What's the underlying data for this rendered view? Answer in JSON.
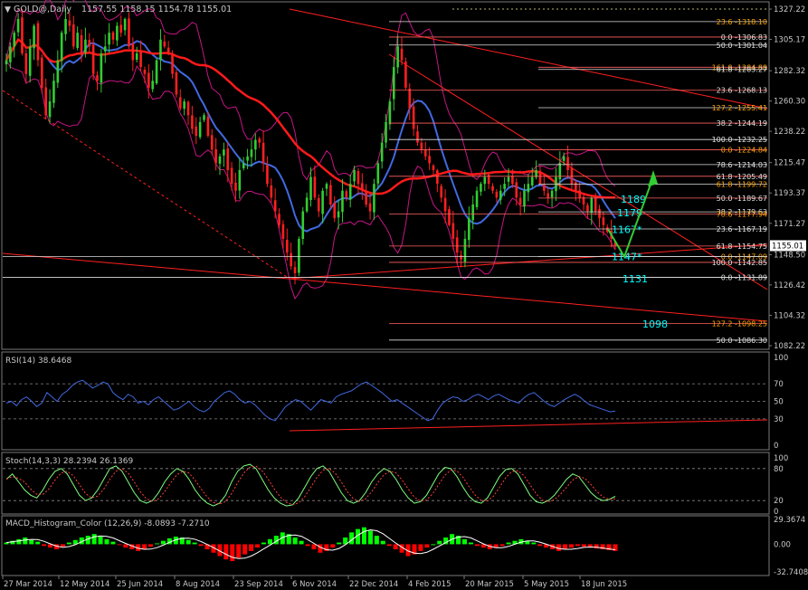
{
  "header": {
    "symbol": "GOLD@,Daily",
    "ohlc": "1157.55 1158.15 1154.78 1155.01"
  },
  "colors": {
    "background": "#000000",
    "grid": "#4a4a4a",
    "axis_text": "#c8c8c8",
    "candle_up": "#32cd32",
    "candle_down": "#ff2020",
    "ma_fast": "#4169e1",
    "ma_slow": "#ff1a1a",
    "bollinger": "#c71585",
    "fib_line": "#ffffff",
    "fib_label": "#ffa500",
    "trend_line": "#ff2020",
    "label_cyan": "#00ffff",
    "arrow_green": "#32cd32",
    "rsi_line": "#4169e1",
    "stoch_main": "#7fff7f",
    "macd_up": "#00ff00",
    "macd_down": "#ff0000",
    "last_price_bg": "#ffffff"
  },
  "chart_data": [
    {
      "type": "candlestick",
      "name": "price",
      "y_ticks": [
        "1327.22",
        "1305.17",
        "1282.32",
        "1260.30",
        "1238.22",
        "1215.47",
        "1193.37",
        "1171.27",
        "1148.50",
        "1126.42",
        "1104.32",
        "1082.22"
      ],
      "ylim": [
        1082.22,
        1327.22
      ],
      "last_price": "1155.01",
      "x_labels": [
        "27 Mar 2014",
        "12 May 2014",
        "25 Jun 2014",
        "8 Aug 2014",
        "23 Sep 2014",
        "6 Nov 2014",
        "22 Dec 2014",
        "4 Feb 2015",
        "20 Mar 2015",
        "5 May 2015",
        "18 Jun 2015"
      ],
      "close_path": [
        1290,
        1300,
        1310,
        1320,
        1295,
        1280,
        1300,
        1315,
        1290,
        1270,
        1250,
        1260,
        1275,
        1290,
        1310,
        1320,
        1315,
        1300,
        1310,
        1295,
        1305,
        1300,
        1280,
        1275,
        1295,
        1300,
        1310,
        1305,
        1315,
        1310,
        1320,
        1300,
        1290,
        1295,
        1285,
        1280,
        1270,
        1275,
        1290,
        1305,
        1300,
        1295,
        1280,
        1265,
        1255,
        1260,
        1250,
        1240,
        1235,
        1245,
        1250,
        1235,
        1225,
        1215,
        1220,
        1225,
        1210,
        1200,
        1195,
        1210,
        1215,
        1220,
        1225,
        1232,
        1230,
        1215,
        1200,
        1190,
        1180,
        1170,
        1160,
        1150,
        1140,
        1135,
        1160,
        1180,
        1190,
        1205,
        1190,
        1180,
        1195,
        1200,
        1185,
        1175,
        1180,
        1195,
        1190,
        1200,
        1210,
        1200,
        1195,
        1185,
        1180,
        1200,
        1215,
        1230,
        1245,
        1260,
        1285,
        1300,
        1290,
        1270,
        1255,
        1240,
        1230,
        1225,
        1220,
        1215,
        1210,
        1200,
        1190,
        1180,
        1170,
        1160,
        1150,
        1145,
        1160,
        1175,
        1185,
        1195,
        1200,
        1205,
        1200,
        1195,
        1190,
        1195,
        1200,
        1205,
        1200,
        1190,
        1185,
        1195,
        1200,
        1205,
        1210,
        1200,
        1195,
        1190,
        1195,
        1205,
        1215,
        1220,
        1210,
        1200,
        1195,
        1190,
        1185,
        1180,
        1190,
        1180,
        1175,
        1170,
        1165,
        1160,
        1155
      ],
      "fibonacci_labels": [
        {
          "text": "23.6 -1318.10",
          "value": 1318.1
        },
        {
          "text": "0.0 -1306.83",
          "value": 1306.83
        },
        {
          "text": "50.0 -1301.04",
          "value": 1301.04
        },
        {
          "text": "161.8 -1284.88",
          "value": 1284.88
        },
        {
          "text": "61.8 -1283.27",
          "value": 1283.27
        },
        {
          "text": "23.6 -1268.13",
          "value": 1268.13
        },
        {
          "text": "127.2 -1255.41",
          "value": 1255.41
        },
        {
          "text": "38.2 -1244.19",
          "value": 1244.19
        },
        {
          "text": "100.0 -1232.25",
          "value": 1232.25
        },
        {
          "text": "0.0 -1224.84",
          "value": 1224.84
        },
        {
          "text": "78.6 -1214.03",
          "value": 1214.03
        },
        {
          "text": "61.8 -1205.49",
          "value": 1205.49
        },
        {
          "text": "61.8 -1199.72",
          "value": 1199.72
        },
        {
          "text": "50.0 -1189.67",
          "value": 1189.67
        },
        {
          "text": "38.2 -1179.63",
          "value": 1179.63
        },
        {
          "text": "78.6 -1177.94",
          "value": 1177.94
        },
        {
          "text": "23.6 -1167.19",
          "value": 1167.19
        },
        {
          "text": "61.8 -1154.75",
          "value": 1154.75
        },
        {
          "text": "0.0 -1147.09",
          "value": 1147.09
        },
        {
          "text": "100.0 -1142.85",
          "value": 1142.85
        },
        {
          "text": "0.0 -1131.89",
          "value": 1131.89
        },
        {
          "text": "127.2 -1098.25",
          "value": 1098.25
        },
        {
          "text": "50.0 -1086.30",
          "value": 1086.3
        }
      ],
      "annotations": [
        {
          "text": "1189",
          "value": 1189
        },
        {
          "text": "1179",
          "value": 1179
        },
        {
          "text": "1167*",
          "value": 1167
        },
        {
          "text": "1147*",
          "value": 1147
        },
        {
          "text": "1131",
          "value": 1131
        },
        {
          "text": "1098",
          "value": 1098
        }
      ]
    },
    {
      "type": "line",
      "name": "RSI(14) 38.6468",
      "y_ticks": [
        "100",
        "70",
        "50",
        "30",
        "0"
      ],
      "ylim": [
        0,
        100
      ],
      "levels": [
        70,
        50,
        30
      ],
      "values": [
        48,
        50,
        45,
        52,
        55,
        50,
        44,
        48,
        60,
        55,
        50,
        58,
        62,
        68,
        72,
        74,
        70,
        65,
        68,
        72,
        70,
        60,
        55,
        52,
        58,
        55,
        48,
        50,
        46,
        52,
        55,
        50,
        45,
        40,
        42,
        46,
        50,
        44,
        40,
        38,
        42,
        50,
        55,
        60,
        62,
        58,
        52,
        48,
        50,
        46,
        40,
        34,
        30,
        28,
        36,
        44,
        48,
        52,
        50,
        45,
        40,
        46,
        52,
        50,
        48,
        55,
        58,
        60,
        62,
        66,
        70,
        72,
        68,
        64,
        60,
        55,
        50,
        52,
        48,
        44,
        40,
        36,
        32,
        28,
        30,
        40,
        48,
        52,
        55,
        54,
        50,
        52,
        56,
        58,
        55,
        52,
        56,
        58,
        55,
        52,
        50,
        48,
        54,
        58,
        60,
        55,
        50,
        46,
        44,
        48,
        52,
        55,
        58,
        55,
        50,
        46,
        44,
        42,
        40,
        38,
        39
      ]
    },
    {
      "type": "line",
      "name": "Stoch(14,3,3) 28.2394 26.1369",
      "y_ticks": [
        "100",
        "80",
        "20",
        "0"
      ],
      "ylim": [
        0,
        100
      ],
      "levels": [
        80,
        20
      ],
      "values": [
        60,
        70,
        55,
        40,
        30,
        25,
        40,
        60,
        75,
        80,
        70,
        50,
        30,
        20,
        25,
        40,
        60,
        80,
        85,
        75,
        55,
        35,
        20,
        15,
        20,
        35,
        55,
        70,
        80,
        75,
        60,
        40,
        25,
        15,
        10,
        15,
        30,
        55,
        75,
        85,
        88,
        80,
        60,
        40,
        25,
        15,
        10,
        12,
        25,
        45,
        65,
        80,
        85,
        75,
        55,
        35,
        20,
        15,
        20,
        35,
        55,
        70,
        80,
        75,
        60,
        40,
        25,
        15,
        18,
        30,
        50,
        70,
        82,
        80,
        65,
        45,
        28,
        18,
        15,
        25,
        45,
        65,
        78,
        80,
        70,
        50,
        30,
        18,
        15,
        20,
        30,
        45,
        60,
        70,
        65,
        50,
        35,
        25,
        20,
        22,
        28
      ]
    },
    {
      "type": "bar",
      "name": "MACD_Histogram_Color (12,26,9) -8.0893 -7.2710",
      "y_ticks": [
        "29.3674",
        "0.00",
        "-32.7408"
      ],
      "ylim": [
        -32.7408,
        29.3674
      ],
      "values": [
        2,
        4,
        6,
        8,
        5,
        3,
        -2,
        -4,
        -6,
        -3,
        2,
        5,
        8,
        10,
        12,
        9,
        6,
        3,
        -1,
        -4,
        -6,
        -8,
        -6,
        -3,
        1,
        4,
        7,
        9,
        8,
        5,
        2,
        -2,
        -6,
        -10,
        -14,
        -18,
        -20,
        -16,
        -12,
        -8,
        -4,
        2,
        6,
        10,
        14,
        12,
        8,
        4,
        -2,
        -6,
        -10,
        -8,
        -4,
        2,
        8,
        14,
        18,
        20,
        16,
        10,
        4,
        -2,
        -6,
        -10,
        -14,
        -12,
        -8,
        -4,
        0,
        4,
        8,
        12,
        10,
        6,
        2,
        -2,
        -4,
        -6,
        -4,
        -2,
        2,
        4,
        6,
        4,
        2,
        -2,
        -4,
        -6,
        -8,
        -6,
        -4,
        -2,
        -3,
        -4,
        -5,
        -6,
        -7,
        -8
      ]
    }
  ]
}
